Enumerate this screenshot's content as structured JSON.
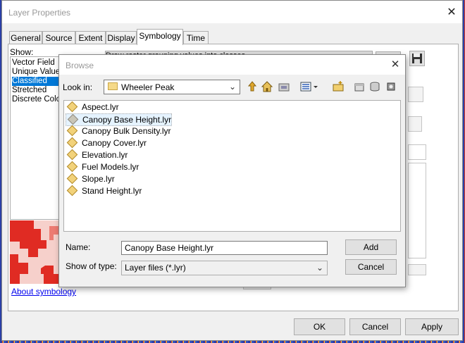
{
  "layer_properties": {
    "title": "Layer Properties",
    "close_glyph": "✕",
    "tabs": [
      {
        "label": "General"
      },
      {
        "label": "Source"
      },
      {
        "label": "Extent"
      },
      {
        "label": "Display"
      },
      {
        "label": "Symbology",
        "active": true
      },
      {
        "label": "Time"
      }
    ],
    "show_label": "Show:",
    "show_items": [
      {
        "label": "Vector Field"
      },
      {
        "label": "Unique Values"
      },
      {
        "label": "Classified",
        "selected": true
      },
      {
        "label": "Stretched"
      },
      {
        "label": "Discrete Color"
      }
    ],
    "description": "Draw raster grouping values into classes",
    "about_link": "About symbology",
    "buttons": {
      "ok": "OK",
      "cancel": "Cancel",
      "apply": "Apply"
    }
  },
  "browse": {
    "title": "Browse",
    "close_glyph": "✕",
    "look_in_label": "Look in:",
    "look_in_value": "Wheeler Peak",
    "toolbar_icons": [
      "up-folder-icon",
      "home-icon",
      "connect-folder-icon",
      "list-view-icon",
      "new-folder-icon",
      "folder-tool-icon",
      "database-icon",
      "gear-icon"
    ],
    "files": [
      {
        "name": "Aspect.lyr"
      },
      {
        "name": "Canopy Base Height.lyr",
        "selected": true
      },
      {
        "name": "Canopy Bulk Density.lyr"
      },
      {
        "name": "Canopy Cover.lyr"
      },
      {
        "name": "Elevation.lyr"
      },
      {
        "name": "Fuel Models.lyr"
      },
      {
        "name": "Slope.lyr"
      },
      {
        "name": "Stand Height.lyr"
      }
    ],
    "name_label": "Name:",
    "name_value": "Canopy Base Height.lyr",
    "type_label": "Show of type:",
    "type_value": "Layer files (*.lyr)",
    "add_label": "Add",
    "cancel_label": "Cancel"
  },
  "colors": {
    "selection": "#0078d7",
    "link": "#0000ee",
    "layer_icon": "#f2d27a"
  }
}
